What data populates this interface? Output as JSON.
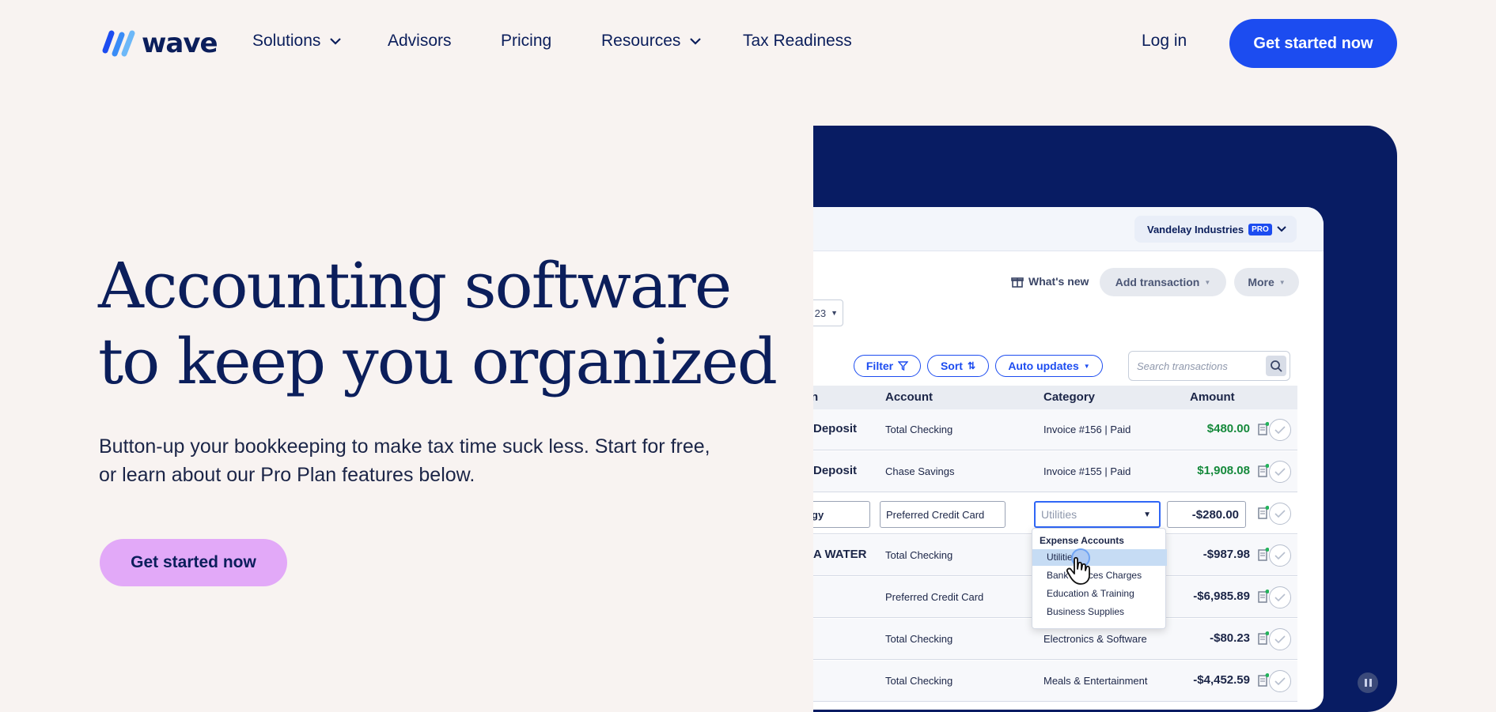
{
  "nav": {
    "logo_text": "wave",
    "items": [
      {
        "label": "Solutions",
        "has_dropdown": true
      },
      {
        "label": "Advisors",
        "has_dropdown": false
      },
      {
        "label": "Pricing",
        "has_dropdown": false
      },
      {
        "label": "Resources",
        "has_dropdown": true
      },
      {
        "label": "Tax Readiness",
        "has_dropdown": false
      }
    ],
    "login_label": "Log in",
    "cta_label": "Get started now"
  },
  "hero": {
    "title_line1": "Accounting software",
    "title_line2": "to keep you organized",
    "subtitle_line1": "Button-up your bookkeeping to make tax time suck less. Start for free,",
    "subtitle_line2": "or learn about our Pro Plan features below.",
    "cta_label": "Get started now"
  },
  "app": {
    "business_name": "Vandelay Industries",
    "business_badge": "PRO",
    "whats_new_label": "What's new",
    "add_transaction_label": "Add transaction",
    "more_label": "More",
    "date_partial": "23",
    "filter_label": "Filter",
    "sort_label": "Sort",
    "auto_updates_label": "Auto updates",
    "search_placeholder": "Search transactions",
    "columns": {
      "description_partial": "n",
      "account": "Account",
      "category": "Category",
      "amount": "Amount"
    },
    "rows": [
      {
        "desc": "Deposit",
        "account": "Total Checking",
        "category": "Invoice #156 | Paid",
        "amount": "$480.00",
        "positive": true
      },
      {
        "desc": "Deposit",
        "account": "Chase Savings",
        "category": "Invoice #155 | Paid",
        "amount": "$1,908.08",
        "positive": true
      },
      {
        "desc": "gy",
        "account": "Preferred Credit Card",
        "category": "Utilities",
        "amount": "-$280.00",
        "positive": false,
        "editing": true
      },
      {
        "desc": "A WATER",
        "account": "Total Checking",
        "category": "",
        "amount": "-$987.98",
        "positive": false
      },
      {
        "desc": "",
        "account": "Preferred Credit Card",
        "category": "",
        "amount": "-$6,985.89",
        "positive": false
      },
      {
        "desc": "",
        "account": "Total Checking",
        "category": "Electronics & Software",
        "amount": "-$80.23",
        "positive": false
      },
      {
        "desc": "",
        "account": "Total Checking",
        "category": "Meals & Entertainment",
        "amount": "-$4,452.59",
        "positive": false
      }
    ],
    "dropdown": {
      "group_label": "Expense Accounts",
      "options": [
        "Utilities",
        "Bank Services Charges",
        "Education & Training",
        "Business Supplies"
      ],
      "visible_options": [
        "Utilitie",
        "Bank",
        "ces Charges",
        "Education & Training",
        "Business Supplies"
      ],
      "selected": "Utilities"
    }
  },
  "colors": {
    "page_bg": "#f8f3f1",
    "brand_navy": "#0b1e5b",
    "primary_blue": "#1c4cf0",
    "hero_cta": "#e2a9f8",
    "panel_bg": "#081c63",
    "positive_amount": "#168a3c"
  },
  "icons": {
    "logo": "wave-logo-icon",
    "chevron": "chevron-down-icon",
    "gift": "gift-icon",
    "filter": "funnel-icon",
    "sort": "sort-arrows-icon",
    "search": "search-icon",
    "receipt": "receipt-icon",
    "check": "check-circle-icon",
    "pause": "pause-icon",
    "cursor": "hand-pointer-icon"
  }
}
